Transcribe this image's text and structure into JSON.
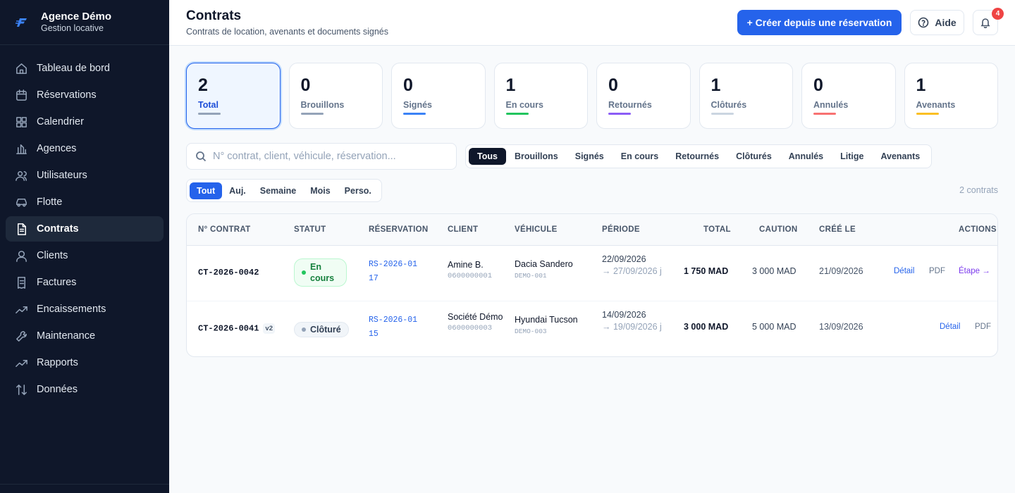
{
  "brand": {
    "name": "Agence Démo",
    "subtitle": "Gestion locative"
  },
  "sidebar": {
    "items": [
      {
        "label": "Tableau de bord",
        "icon": "home-icon",
        "active": false
      },
      {
        "label": "Réservations",
        "icon": "calendar-icon",
        "active": false
      },
      {
        "label": "Calendrier",
        "icon": "grid-icon",
        "active": false
      },
      {
        "label": "Agences",
        "icon": "building-icon",
        "active": false
      },
      {
        "label": "Utilisateurs",
        "icon": "users-icon",
        "active": false
      },
      {
        "label": "Flotte",
        "icon": "car-icon",
        "active": false
      },
      {
        "label": "Contrats",
        "icon": "document-icon",
        "active": true
      },
      {
        "label": "Clients",
        "icon": "user-icon",
        "active": false
      },
      {
        "label": "Factures",
        "icon": "invoice-icon",
        "active": false
      },
      {
        "label": "Encaissements",
        "icon": "trend-icon",
        "active": false
      },
      {
        "label": "Maintenance",
        "icon": "wrench-icon",
        "active": false
      },
      {
        "label": "Rapports",
        "icon": "chart-icon",
        "active": false
      },
      {
        "label": "Données",
        "icon": "sort-icon",
        "active": false
      }
    ]
  },
  "header": {
    "title": "Contrats",
    "subtitle": "Contrats de location, avenants et documents signés",
    "create_label": "+ Créer depuis une réservation",
    "help_label": "Aide",
    "notifications_count": "4"
  },
  "stats": [
    {
      "value": "2",
      "label": "Total",
      "color": "#94a3b8",
      "active": true
    },
    {
      "value": "0",
      "label": "Brouillons",
      "color": "#94a3b8"
    },
    {
      "value": "0",
      "label": "Signés",
      "color": "#3b82f6"
    },
    {
      "value": "1",
      "label": "En cours",
      "color": "#22c55e"
    },
    {
      "value": "0",
      "label": "Retournés",
      "color": "#8b5cf6"
    },
    {
      "value": "1",
      "label": "Clôturés",
      "color": "#cbd5e1"
    },
    {
      "value": "0",
      "label": "Annulés",
      "color": "#f87171"
    },
    {
      "value": "1",
      "label": "Avenants",
      "color": "#fbbf24"
    }
  ],
  "search": {
    "placeholder": "N° contrat, client, véhicule, réservation..."
  },
  "status_tabs": [
    "Tous",
    "Brouillons",
    "Signés",
    "En cours",
    "Retournés",
    "Clôturés",
    "Annulés",
    "Litige",
    "Avenants"
  ],
  "status_tab_active": "Tous",
  "period_tabs": [
    "Tout",
    "Auj.",
    "Semaine",
    "Mois",
    "Perso."
  ],
  "period_tab_active": "Tout",
  "count_label": "2 contrats",
  "table": {
    "headers": {
      "contract": "N° CONTRAT",
      "status": "STATUT",
      "reservation": "RÉSERVATION",
      "client": "CLIENT",
      "vehicle": "VÉHICULE",
      "period": "PÉRIODE",
      "total": "TOTAL",
      "deposit": "CAUTION",
      "created": "CRÉÉ LE",
      "actions": "ACTIONS"
    },
    "rows": [
      {
        "contract": "CT-2026-0042",
        "version": "",
        "status": "En cours",
        "reservation": "RS-2026-0117",
        "client": "Amine B.",
        "phone": "0600000001",
        "vehicle": "Dacia Sandero",
        "vehicle_code": "DEMO-001",
        "period_start": "22/09/2026",
        "period_end": "→ 27/09/2026 j",
        "total": "1 750 MAD",
        "deposit": "3 000 MAD",
        "created": "21/09/2026",
        "action_detail": "Détail",
        "action_pdf": "PDF",
        "action_step": "Étape →"
      },
      {
        "contract": "CT-2026-0041",
        "version": "v2",
        "status": "Clôturé",
        "reservation": "RS-2026-0115",
        "client": "Société Démo",
        "phone": "0600000003",
        "vehicle": "Hyundai Tucson",
        "vehicle_code": "DEMO-003",
        "period_start": "14/09/2026",
        "period_end": "→ 19/09/2026 j",
        "total": "3 000 MAD",
        "deposit": "5 000 MAD",
        "created": "13/09/2026",
        "action_detail": "Détail",
        "action_pdf": "PDF"
      }
    ]
  }
}
